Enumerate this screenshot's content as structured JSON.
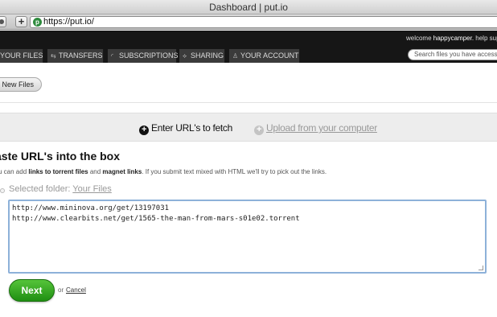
{
  "window": {
    "title": "Dashboard | put.io"
  },
  "browser": {
    "url": "https://put.io/",
    "favicon_icon": "putio-favicon-icon"
  },
  "nav": {
    "welcome_prefix": "welcome",
    "username": "happycamper.",
    "help": "help",
    "support": "supp",
    "tabs": [
      {
        "label": "YOUR FILES",
        "icon": "files-icon"
      },
      {
        "label": "TRANSFERS",
        "icon": "transfer-arrows-icon"
      },
      {
        "label": "SUBSCRIPTIONS",
        "icon": "rss-icon"
      },
      {
        "label": "SHARING",
        "icon": "share-icon"
      },
      {
        "label": "YOUR ACCOUNT",
        "icon": "person-icon"
      }
    ],
    "search_placeholder": "Search files you have access"
  },
  "new_files_button": "New Files",
  "fetch_options": {
    "enter_url": "Enter URL's to fetch",
    "upload": "Upload from your computer"
  },
  "main": {
    "heading": "aste URL's into the box",
    "desc_1": "u can add ",
    "desc_bold_1": "links to torrent files",
    "desc_2": " and ",
    "desc_bold_2": "magnet links",
    "desc_3": ". If you submit text mixed with HTML we'll try to pick out the links.",
    "folder_label": "Selected folder: ",
    "folder_link": "Your Files",
    "urls": [
      "http://www.mininova.org/get/13197031",
      "http://www.clearbits.net/get/1565-the-man-from-mars-s01e02.torrent"
    ]
  },
  "actions": {
    "next": "Next",
    "or": "or",
    "cancel": "Cancel"
  },
  "colors": {
    "nav_bg": "#161616",
    "tab_bg": "#3b3b3b",
    "next_green": "#2fa81d",
    "textarea_border": "#8db1d9"
  }
}
